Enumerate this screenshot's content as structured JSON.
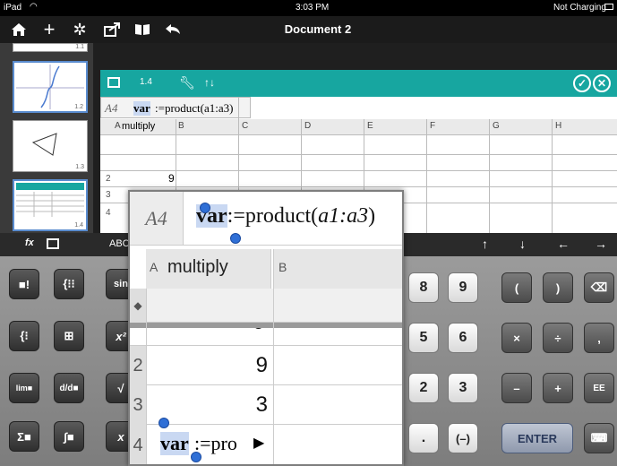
{
  "status": {
    "device": "iPad",
    "time": "3:03 PM",
    "charging": "Not Charging"
  },
  "toolbar": {
    "title": "Document 2"
  },
  "pages": [
    {
      "label": "1.1"
    },
    {
      "label": "1.2"
    },
    {
      "label": "1.3"
    },
    {
      "label": "1.4"
    }
  ],
  "spreadsheet": {
    "tab": "1.4",
    "cell_ref": "A4",
    "formula_var": "var",
    "formula_rest": ":=product(a1:a3)",
    "formula_fn": "product(",
    "formula_arg": "a1:a3",
    "formula_close": ")",
    "column_headers": [
      "A",
      "B",
      "C",
      "D",
      "E",
      "F",
      "G",
      "H"
    ],
    "col_a_name": "multiply",
    "rows": [
      {
        "num": "1",
        "a": ""
      },
      {
        "num": "2",
        "a": "9"
      },
      {
        "num": "3",
        "a": "3"
      },
      {
        "num": "4",
        "a": "var"
      }
    ],
    "row_marker": "◆",
    "partial_first_value": "6",
    "truncated_formula": ":=pro"
  },
  "keyboard": {
    "entry_fx": "fx",
    "entry_abc": "ABC",
    "arrows": [
      "↑",
      "↓",
      "←",
      "→"
    ],
    "digits": [
      "8",
      "9",
      "5",
      "6",
      "2",
      "3",
      ".",
      "(–)"
    ],
    "parens": [
      "(",
      ")"
    ],
    "ops": [
      "×",
      "÷",
      ",",
      "–",
      "+",
      "EE"
    ],
    "enter": "ENTER",
    "fn_labels": [
      "sin",
      "x²",
      "√",
      "x"
    ]
  }
}
